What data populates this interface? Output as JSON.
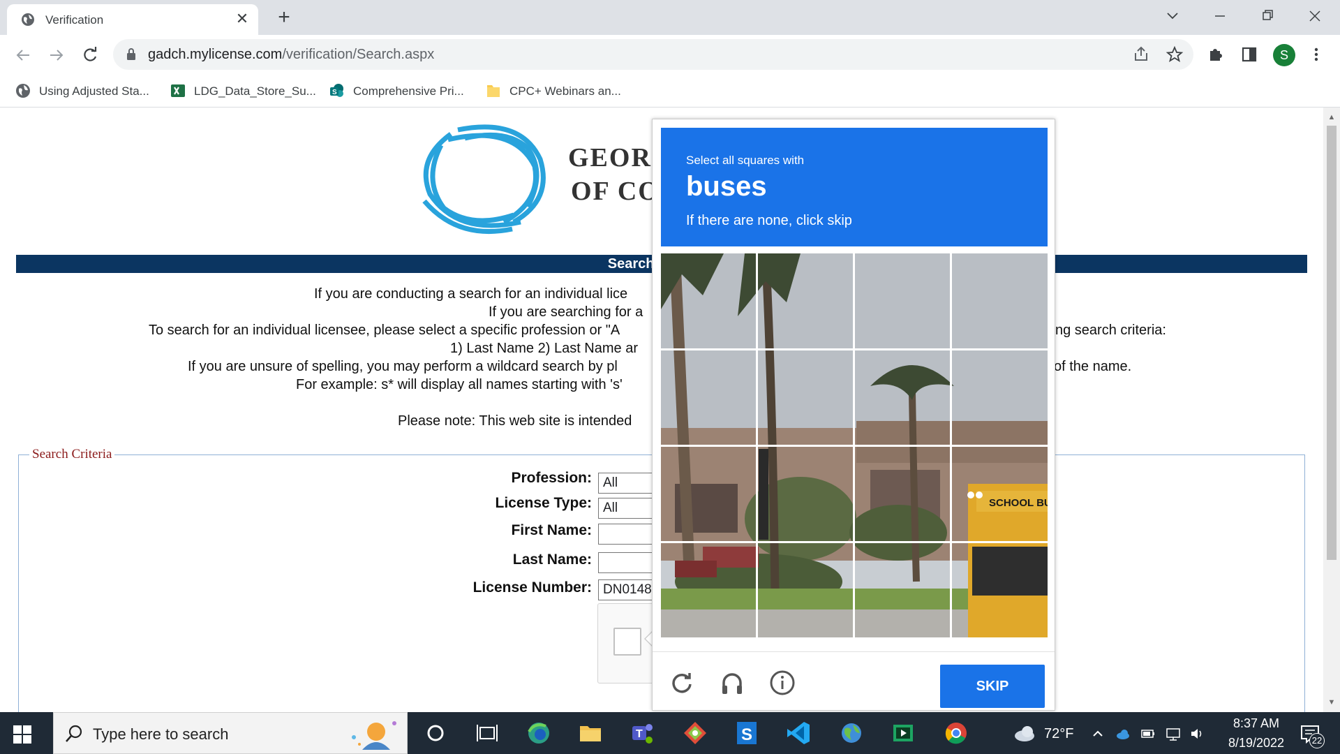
{
  "browser": {
    "tab_title": "Verification",
    "url_host": "gadch.mylicense.com",
    "url_path": "/verification/Search.aspx",
    "profile_initial": "S",
    "bookmarks": [
      {
        "label": "Using Adjusted Sta...",
        "icon": "globe-icon"
      },
      {
        "label": "LDG_Data_Store_Su...",
        "icon": "excel-icon"
      },
      {
        "label": "Comprehensive Pri...",
        "icon": "sharepoint-icon"
      },
      {
        "label": "CPC+ Webinars an...",
        "icon": "folder-icon"
      }
    ]
  },
  "page": {
    "logo_line1": "GEORG",
    "logo_line2": "OF CO",
    "banner": "Search for a Pro",
    "intro_lines": [
      "If you are conducting a search for an individual lice",
      "If you are searching for a",
      "To search for an individual licensee, please select a specific profession or \"A",
      "ng search criteria:",
      "1) Last Name 2) Last Name ar",
      "If you are unsure of spelling, you may perform a wildcard search by pl",
      "of the name.",
      "For example: s* will display all names starting with 's'",
      "Please note: This web site is intended"
    ],
    "search_criteria_legend": "Search Criteria",
    "form": {
      "profession_label": "Profession:",
      "profession_value": "All",
      "license_type_label": "License Type:",
      "license_type_value": "All",
      "first_name_label": "First Name:",
      "first_name_value": "",
      "last_name_label": "Last Name:",
      "last_name_value": "",
      "license_number_label": "License Number:",
      "license_number_value": "DN0148"
    }
  },
  "captcha": {
    "instruction": "Select all squares with",
    "target": "buses",
    "subtext": "If there are none, click skip",
    "skip_label": "SKIP",
    "grid_rows": 4,
    "grid_cols": 4,
    "school_bus_text": "SCHOOL BU",
    "colors": {
      "header": "#1a73e8",
      "button": "#1a73e8"
    }
  },
  "taskbar": {
    "search_placeholder": "Type here to search",
    "temperature": "72°F",
    "time": "8:37 AM",
    "date": "8/19/2022",
    "notification_count": "22"
  }
}
